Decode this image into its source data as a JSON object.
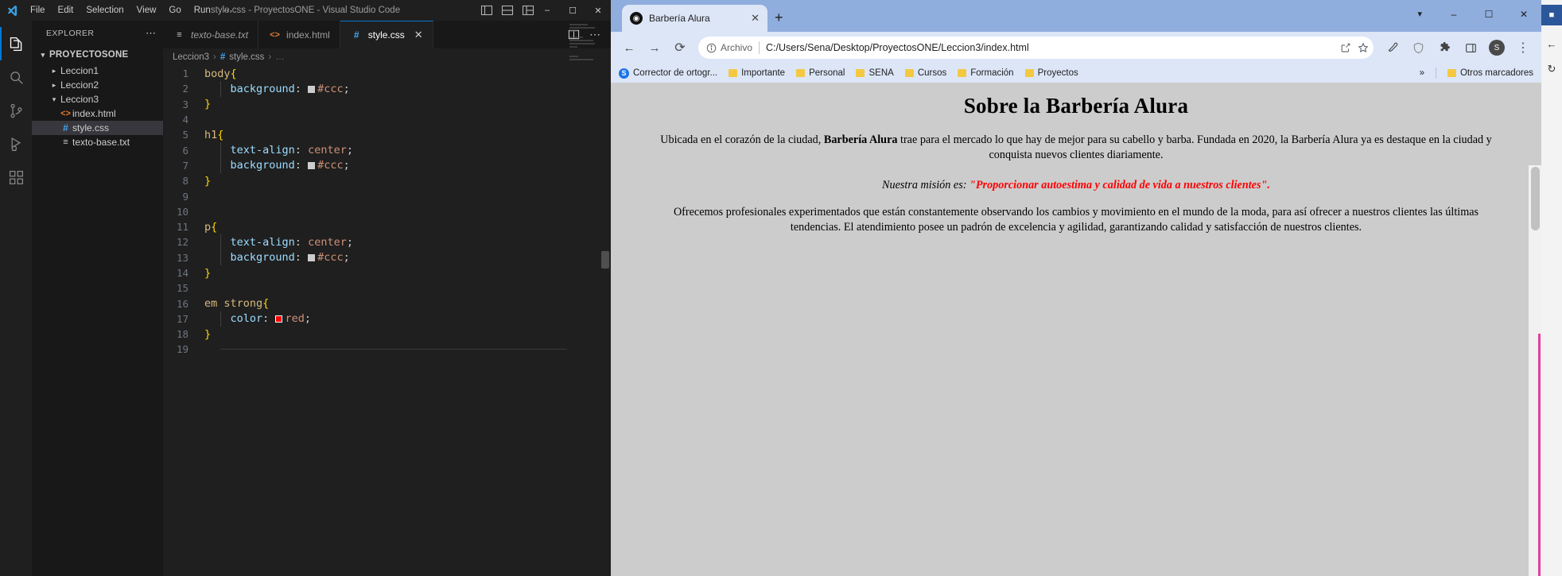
{
  "vscode": {
    "window_title": "style.css - ProyectosONE - Visual Studio Code",
    "logo_icon": "vscode-logo-icon",
    "menu": [
      "File",
      "Edit",
      "Selection",
      "View",
      "Go",
      "Run",
      "⋯"
    ],
    "title_actions": [
      "layout-panel-icon",
      "layout-sidebar-icon",
      "layout-grid-icon"
    ],
    "window_controls": [
      "–",
      "☐",
      "✕"
    ],
    "activitybar": [
      {
        "name": "explorer",
        "icon": "files-icon",
        "active": true
      },
      {
        "name": "search",
        "icon": "search-icon",
        "active": false
      },
      {
        "name": "source-control",
        "icon": "source-control-icon",
        "active": false
      },
      {
        "name": "run-and-debug",
        "icon": "run-debug-icon",
        "active": false
      },
      {
        "name": "extensions",
        "icon": "extensions-icon",
        "active": false
      }
    ],
    "sidebar": {
      "header": "EXPLORER",
      "header_more": "⋯",
      "root": "PROYECTOSONE",
      "tree": [
        {
          "label": "Leccion1",
          "type": "folder",
          "expanded": false,
          "depth": 1,
          "selected": false,
          "icon": "chevron-right-icon"
        },
        {
          "label": "Leccion2",
          "type": "folder",
          "expanded": false,
          "depth": 1,
          "selected": false,
          "icon": "chevron-right-icon"
        },
        {
          "label": "Leccion3",
          "type": "folder",
          "expanded": true,
          "depth": 1,
          "selected": false,
          "icon": "chevron-down-icon"
        },
        {
          "label": "index.html",
          "type": "html",
          "depth": 2,
          "selected": false,
          "icon": "html-file-icon"
        },
        {
          "label": "style.css",
          "type": "css",
          "depth": 2,
          "selected": true,
          "icon": "css-file-icon"
        },
        {
          "label": "texto-base.txt",
          "type": "txt",
          "depth": 2,
          "selected": false,
          "icon": "text-file-icon"
        }
      ]
    },
    "tabs": [
      {
        "label": "texto-base.txt",
        "icon": "text-file-icon",
        "active": false,
        "italic": true,
        "close": false
      },
      {
        "label": "index.html",
        "icon": "html-file-icon",
        "active": false,
        "italic": false,
        "close": false
      },
      {
        "label": "style.css",
        "icon": "css-file-icon",
        "active": true,
        "italic": false,
        "close": true,
        "close_label": "✕"
      }
    ],
    "tabbar_actions": [
      "split-editor-icon",
      "more-actions-icon"
    ],
    "breadcrumb": [
      "Leccion3",
      "style.css",
      "…"
    ],
    "editor": {
      "language": "css",
      "lines": [
        {
          "n": 1,
          "tokens": [
            {
              "t": "sel",
              "v": "body"
            },
            {
              "t": "brace",
              "v": "{"
            }
          ]
        },
        {
          "n": 2,
          "indent": true,
          "tokens": [
            {
              "t": "prop",
              "v": "    background"
            },
            {
              "t": "punc",
              "v": ":"
            },
            {
              "t": "swatch",
              "v": "#ccc"
            },
            {
              "t": "val",
              "v": "#ccc"
            },
            {
              "t": "punc",
              "v": ";"
            }
          ]
        },
        {
          "n": 3,
          "tokens": [
            {
              "t": "brace",
              "v": "}"
            }
          ]
        },
        {
          "n": 4,
          "tokens": []
        },
        {
          "n": 5,
          "tokens": [
            {
              "t": "sel",
              "v": "h1"
            },
            {
              "t": "brace",
              "v": "{"
            }
          ]
        },
        {
          "n": 6,
          "indent": true,
          "tokens": [
            {
              "t": "prop",
              "v": "    text-align"
            },
            {
              "t": "punc",
              "v": ":"
            },
            {
              "t": "val",
              "v": " center"
            },
            {
              "t": "punc",
              "v": ";"
            }
          ]
        },
        {
          "n": 7,
          "indent": true,
          "tokens": [
            {
              "t": "prop",
              "v": "    background"
            },
            {
              "t": "punc",
              "v": ":"
            },
            {
              "t": "swatch",
              "v": "#ccc"
            },
            {
              "t": "val",
              "v": "#ccc"
            },
            {
              "t": "punc",
              "v": ";"
            }
          ]
        },
        {
          "n": 8,
          "tokens": [
            {
              "t": "brace",
              "v": "}"
            }
          ]
        },
        {
          "n": 9,
          "tokens": []
        },
        {
          "n": 10,
          "tokens": []
        },
        {
          "n": 11,
          "tokens": [
            {
              "t": "sel",
              "v": "p"
            },
            {
              "t": "brace",
              "v": "{"
            }
          ]
        },
        {
          "n": 12,
          "indent": true,
          "tokens": [
            {
              "t": "prop",
              "v": "    text-align"
            },
            {
              "t": "punc",
              "v": ":"
            },
            {
              "t": "val",
              "v": " center"
            },
            {
              "t": "punc",
              "v": ";"
            }
          ]
        },
        {
          "n": 13,
          "indent": true,
          "tokens": [
            {
              "t": "prop",
              "v": "    background"
            },
            {
              "t": "punc",
              "v": ":"
            },
            {
              "t": "swatch",
              "v": "#ccc"
            },
            {
              "t": "val",
              "v": "#ccc"
            },
            {
              "t": "punc",
              "v": ";"
            }
          ]
        },
        {
          "n": 14,
          "tokens": [
            {
              "t": "brace",
              "v": "}"
            }
          ]
        },
        {
          "n": 15,
          "tokens": []
        },
        {
          "n": 16,
          "tokens": [
            {
              "t": "sel",
              "v": "em strong"
            },
            {
              "t": "brace",
              "v": "{"
            }
          ]
        },
        {
          "n": 17,
          "indent": true,
          "tokens": [
            {
              "t": "prop",
              "v": "    color"
            },
            {
              "t": "punc",
              "v": ":"
            },
            {
              "t": "swatch-red",
              "v": "red"
            },
            {
              "t": "val",
              "v": "red"
            },
            {
              "t": "punc",
              "v": ";"
            }
          ]
        },
        {
          "n": 18,
          "tokens": [
            {
              "t": "brace",
              "v": "}"
            }
          ]
        },
        {
          "n": 19,
          "tokens": []
        }
      ],
      "cursor_line": 19,
      "colors": {
        "selector": "#d7ba7d",
        "brace": "#ffd700",
        "property": "#9cdcfe",
        "value": "#ce9178",
        "swatch_ccc": "#cccccc",
        "swatch_red": "#ff0000",
        "background": "#1f1f1f",
        "line_number": "#6e7681"
      }
    }
  },
  "browser": {
    "tab": {
      "title": "Barbería Alura",
      "favicon": "globe-icon",
      "close_label": "✕"
    },
    "newtab_label": "+",
    "window_controls": [
      "–",
      "☐",
      "✕"
    ],
    "tab_list_chevron": "chevron-down-icon",
    "toolbar": {
      "back": "←",
      "forward": "→",
      "reload": "⟳",
      "info_icon": "info-circle-icon",
      "scheme_label": "Archivo",
      "url": "C:/Users/Sena/Desktop/ProyectosONE/Leccion3/index.html",
      "share_icon": "share-icon",
      "bookmark_icon": "star-icon",
      "right_icons": [
        "eyedropper-icon",
        "shield-icon",
        "puzzle-icon",
        "sidepanel-icon"
      ],
      "avatar_label": "S",
      "menu_icon": "three-dots-vertical-icon"
    },
    "bookmarks": [
      {
        "label": "Corrector de ortogr...",
        "icon": "spellcheck-icon"
      },
      {
        "label": "Importante",
        "icon": "folder-icon"
      },
      {
        "label": "Personal",
        "icon": "folder-icon"
      },
      {
        "label": "SENA",
        "icon": "folder-icon"
      },
      {
        "label": "Cursos",
        "icon": "folder-icon"
      },
      {
        "label": "Formación",
        "icon": "folder-icon"
      },
      {
        "label": "Proyectos",
        "icon": "folder-icon"
      }
    ],
    "bookmarks_overflow": "»",
    "other_bookmarks": {
      "label": "Otros marcadores",
      "icon": "folder-icon"
    },
    "page": {
      "heading": "Sobre la Barbería Alura",
      "paragraph1_a": "Ubicada en el corazón de la ciudad, ",
      "paragraph1_bold": "Barbería Alura",
      "paragraph1_b": " trae para el mercado lo que hay de mejor para su cabello y barba. Fundada en 2020, la Barbería Alura ya es destaque en la ciudad y conquista nuevos clientes diariamente.",
      "mission_label": "Nuestra misión es: ",
      "mission_quote": "\"Proporcionar autoestima y calidad de vida a nuestros clientes\".",
      "paragraph3": "Ofrecemos profesionales experimentados que están constantemente observando los cambios y movimiento en el mundo de la moda, para así ofrecer a nuestros clientes las últimas tendencias. El atendimiento posee un padrón de excelencia y agilidad, garantizando calidad y satisfacción de nuestros clientes.",
      "background_color": "#cccccc",
      "mission_color": "#ff0000"
    }
  },
  "edge_strip": {
    "top_icon": "office-icon",
    "icons": [
      "back-arrow-icon",
      "refresh-icon"
    ]
  }
}
